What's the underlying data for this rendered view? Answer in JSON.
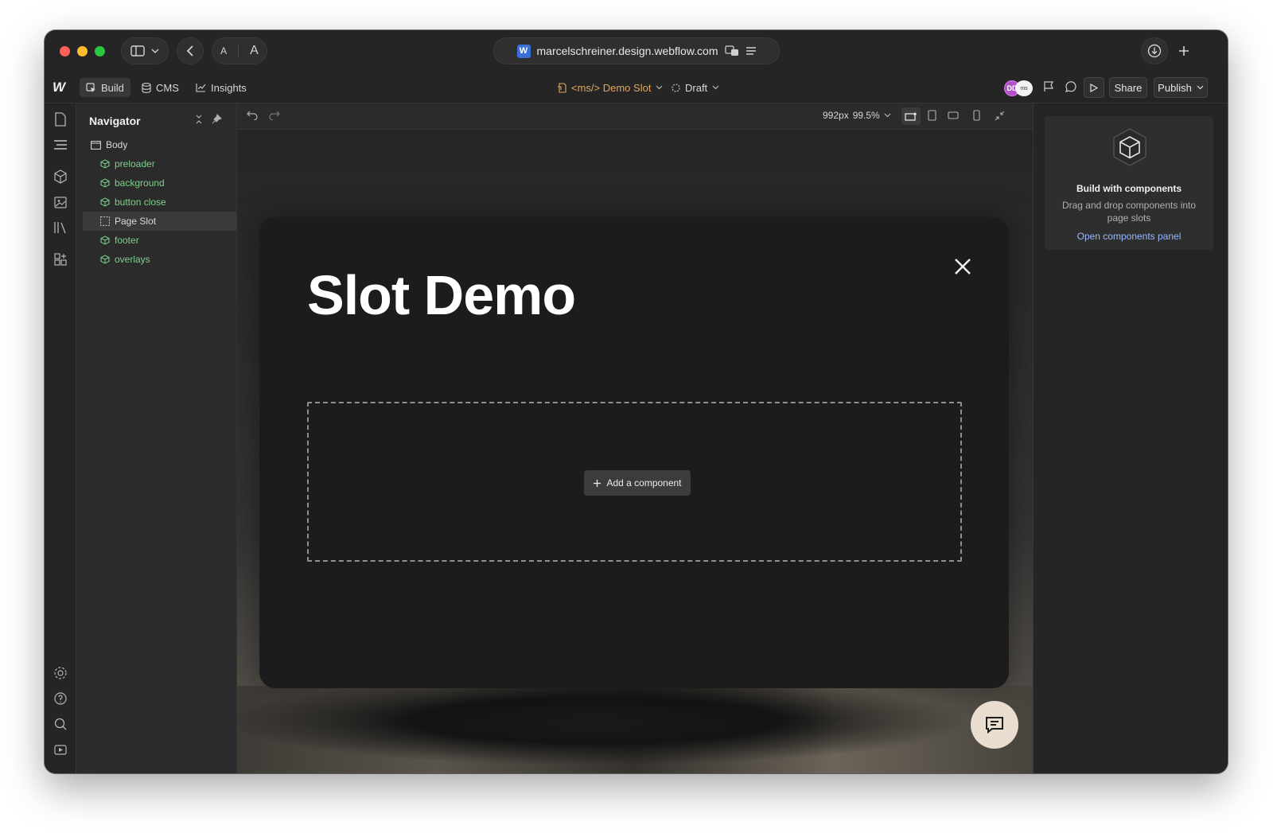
{
  "browser": {
    "url": "marcelschreiner.design.webflow.com",
    "favicon": "webflow-favicon",
    "reader_small": "A",
    "reader_large": "A"
  },
  "toolbar": {
    "logo": "W",
    "tabs": [
      {
        "label": "Build",
        "icon": "cursor-icon",
        "active": true
      },
      {
        "label": "CMS",
        "icon": "database-icon",
        "active": false
      },
      {
        "label": "Insights",
        "icon": "chart-icon",
        "active": false
      }
    ],
    "page_label": "<ms/> Demo Slot",
    "status_label": "Draft",
    "avatar_initials": "DD",
    "avatar2_label": "ms",
    "share_label": "Share",
    "publish_label": "Publish"
  },
  "navigator": {
    "title": "Navigator",
    "items": [
      {
        "label": "Body",
        "type": "element",
        "indent": 0
      },
      {
        "label": "preloader",
        "type": "component",
        "indent": 1
      },
      {
        "label": "background",
        "type": "component",
        "indent": 1
      },
      {
        "label": "button close",
        "type": "component",
        "indent": 1
      },
      {
        "label": "Page Slot",
        "type": "slot",
        "indent": 1,
        "selected": true
      },
      {
        "label": "footer",
        "type": "component",
        "indent": 1
      },
      {
        "label": "overlays",
        "type": "component",
        "indent": 1
      }
    ]
  },
  "canvas": {
    "width_label": "992px",
    "zoom_label": "99.5%",
    "modal_title": "Slot Demo",
    "add_component_label": "Add a component"
  },
  "right_panel": {
    "title": "Build with components",
    "description": "Drag and drop components into page slots",
    "link": "Open components panel"
  },
  "colors": {
    "component_green": "#7ecf8c",
    "link_blue": "#9ab8ff",
    "avatar_purple": "#b452c8",
    "chat_bubble": "#e9ddd0"
  }
}
